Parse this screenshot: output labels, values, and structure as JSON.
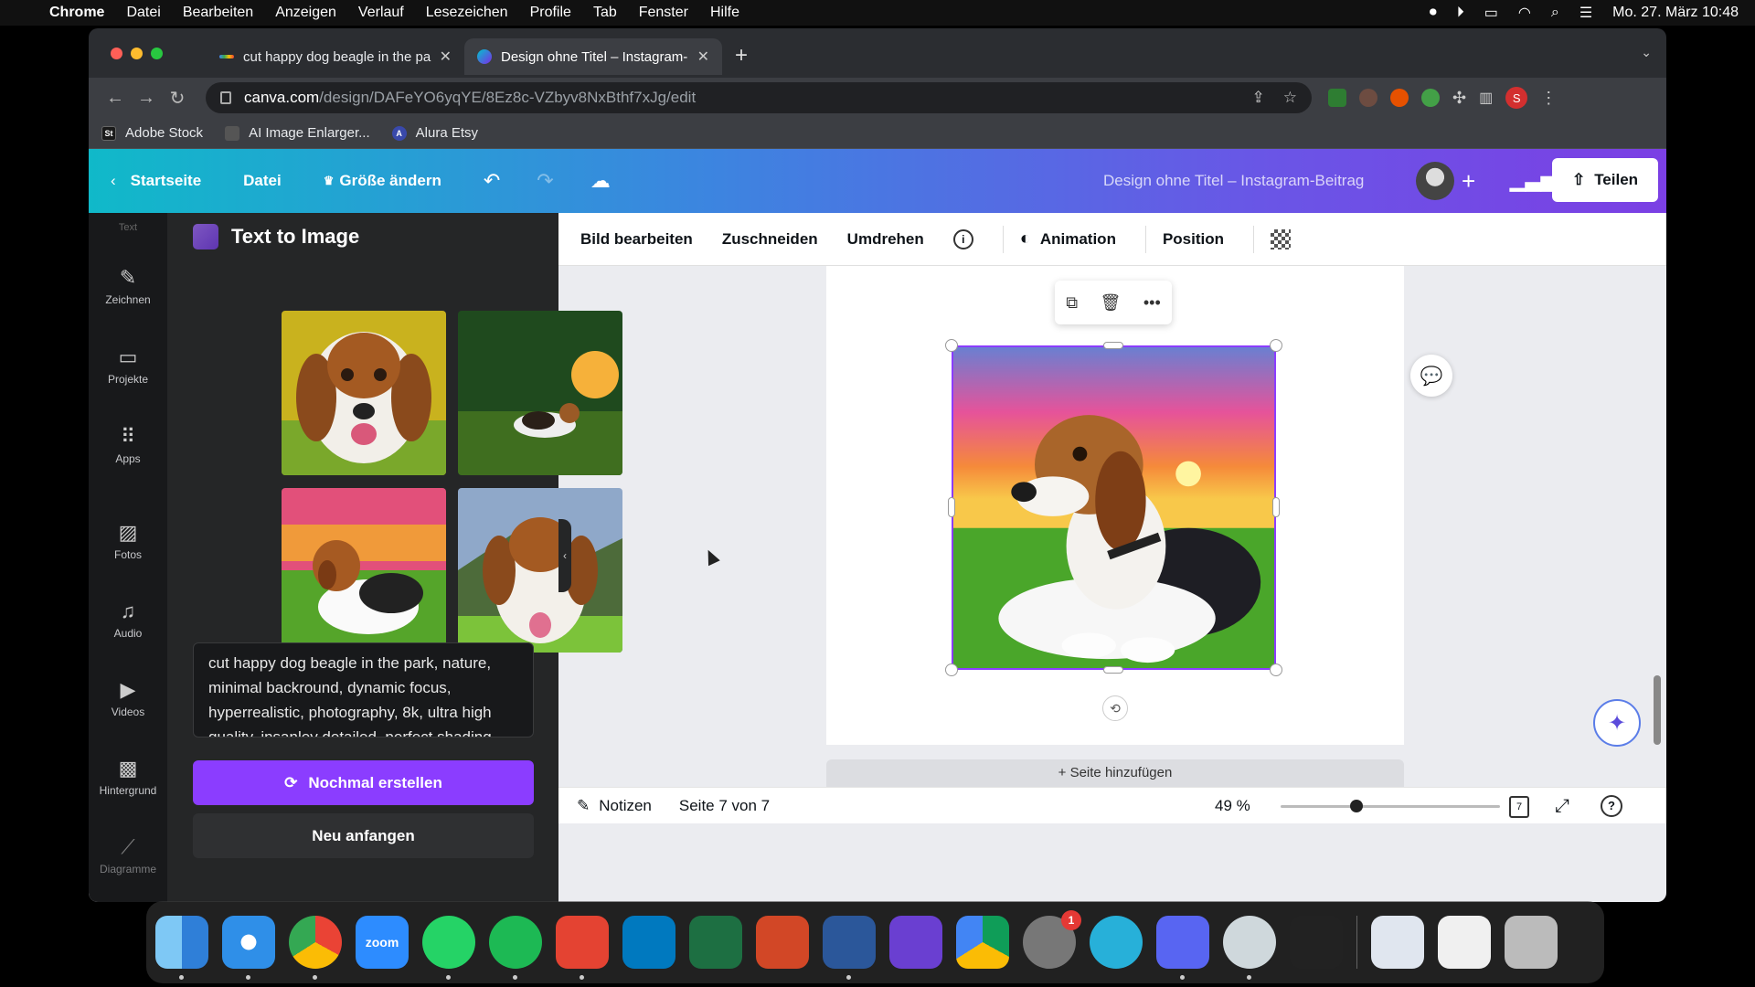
{
  "menubar": {
    "app": "Chrome",
    "items": [
      "Datei",
      "Bearbeiten",
      "Anzeigen",
      "Verlauf",
      "Lesezeichen",
      "Profile",
      "Tab",
      "Fenster",
      "Hilfe"
    ],
    "clock": "Mo. 27. März  10:48"
  },
  "browser": {
    "tabs": [
      {
        "title": "cut happy dog beagle in the pa"
      },
      {
        "title": "Design ohne Titel – Instagram-"
      }
    ],
    "url_host": "canva.com",
    "url_path": "/design/DAFeYO6yqYE/8Ez8c-VZbyv8NxBthf7xJg/edit",
    "bookmarks": [
      "Adobe Stock",
      "AI Image Enlarger...",
      "Alura Etsy"
    ],
    "profile_initial": "S",
    "ext_badge": "4"
  },
  "canva_header": {
    "home": "Startseite",
    "file": "Datei",
    "resize": "Größe ändern",
    "doc_title": "Design ohne Titel – Instagram-Beitrag",
    "share": "Teilen"
  },
  "siderail": {
    "top_label": "Text",
    "items": [
      "Zeichnen",
      "Projekte",
      "Apps",
      "Fotos",
      "Audio",
      "Videos",
      "Hintergrund",
      "Diagramme"
    ]
  },
  "panel": {
    "title": "Text to Image",
    "prompt": "cut happy dog beagle in the park, nature, minimal backround, dynamic focus, hyperrealistic, photography, 8k, ultra high quality, insanley detailed, perfect shading",
    "regen_button": "Nochmal erstellen",
    "restart_button": "Neu anfangen"
  },
  "context_toolbar": {
    "edit_image": "Bild bearbeiten",
    "crop": "Zuschneiden",
    "flip": "Umdrehen",
    "animation": "Animation",
    "position": "Position"
  },
  "canvas": {
    "add_page": "+ Seite hinzufügen"
  },
  "footer": {
    "notes": "Notizen",
    "page_indicator": "Seite 7 von 7",
    "zoom": "49 %",
    "zoom_level": 0.49,
    "page_count": "7"
  },
  "dock": {
    "apps": [
      "Finder",
      "Safari",
      "Chrome",
      "Zoom",
      "WhatsApp",
      "Spotify",
      "Todoist",
      "Trello",
      "Excel",
      "PowerPoint",
      "Word",
      "iMovie",
      "Google Drive",
      "Systemeinstellungen",
      "Mirror",
      "Discord",
      "QuickTime",
      "Sprachmemos",
      "Vorschau",
      "Fenster",
      "Papierkorb"
    ],
    "settings_badge": "1",
    "zoom_label": "zoom"
  },
  "colors": {
    "accent": "#8b3dff",
    "header_gradient_start": "#10b9c9",
    "header_gradient_end": "#7b3fe4"
  }
}
